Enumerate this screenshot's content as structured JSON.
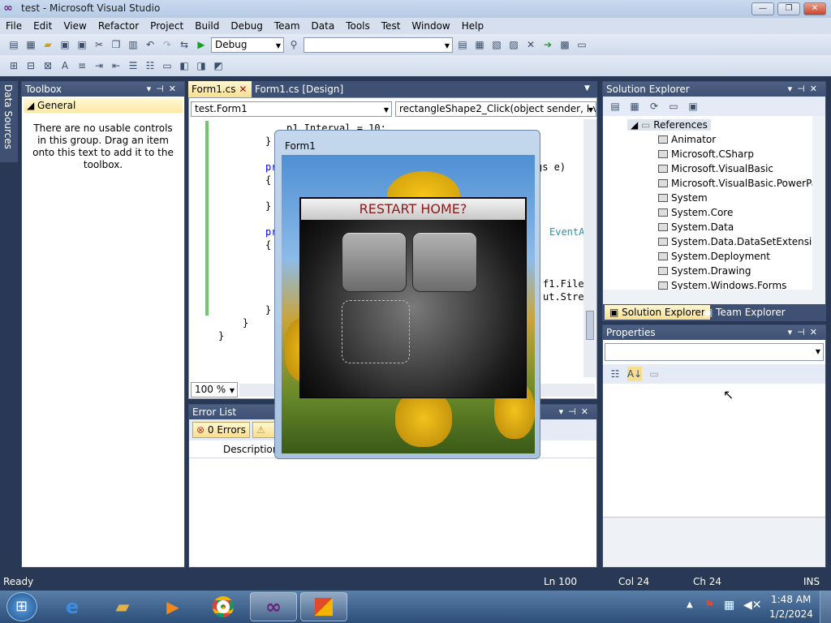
{
  "window": {
    "title": "test - Microsoft Visual Studio",
    "min": "—",
    "max": "❐",
    "close": "✕"
  },
  "menu": [
    "File",
    "Edit",
    "View",
    "Refactor",
    "Project",
    "Build",
    "Debug",
    "Team",
    "Data",
    "Tools",
    "Test",
    "Window",
    "Help"
  ],
  "toolbar": {
    "config": "Debug",
    "search_value": ""
  },
  "toolbox": {
    "title": "Toolbox",
    "group": "General",
    "empty_text": "There are no usable controls in this group. Drag an item onto this text to add it to the toolbox."
  },
  "side_tab": "Data Sources",
  "editor": {
    "tabs": [
      "Form1.cs",
      "Form1.cs [Design]"
    ],
    "class_combo": "test.Form1",
    "member_combo": "rectangleShape2_Click(object sender, Eve",
    "zoom": "100 %",
    "code_lines": [
      "p1.Interval = 10;",
      "}",
      "pr",
      "{",
      "}",
      "pr",
      "{",
      "}",
      "}",
      "}"
    ],
    "code_right": [
      "gs e)",
      "EventA",
      "f1.File",
      "ut.Stre"
    ]
  },
  "form1": {
    "title": "Form1",
    "dialog_title": "RESTART HOME?"
  },
  "error_list": {
    "title": "Error List",
    "errors": "0 Errors",
    "col_description": "Description"
  },
  "solution_explorer": {
    "title": "Solution Explorer",
    "references_label": "References",
    "references": [
      "Animator",
      "Microsoft.CSharp",
      "Microsoft.VisualBasic",
      "Microsoft.VisualBasic.PowerPacks",
      "System",
      "System.Core",
      "System.Data",
      "System.Data.DataSetExtensions",
      "System.Deployment",
      "System.Drawing",
      "System.Windows.Forms"
    ],
    "tab_solution": "Solution Explorer",
    "tab_team": "Team Explorer"
  },
  "properties": {
    "title": "Properties"
  },
  "status": {
    "ready": "Ready",
    "ln": "Ln 100",
    "col": "Col 24",
    "ch": "Ch 24",
    "ins": "INS"
  },
  "clock": {
    "time": "1:48 AM",
    "date": "1/2/2024"
  },
  "colors": {
    "dialog_title": "#8b1a1a",
    "accent_vs": "#68217a"
  }
}
